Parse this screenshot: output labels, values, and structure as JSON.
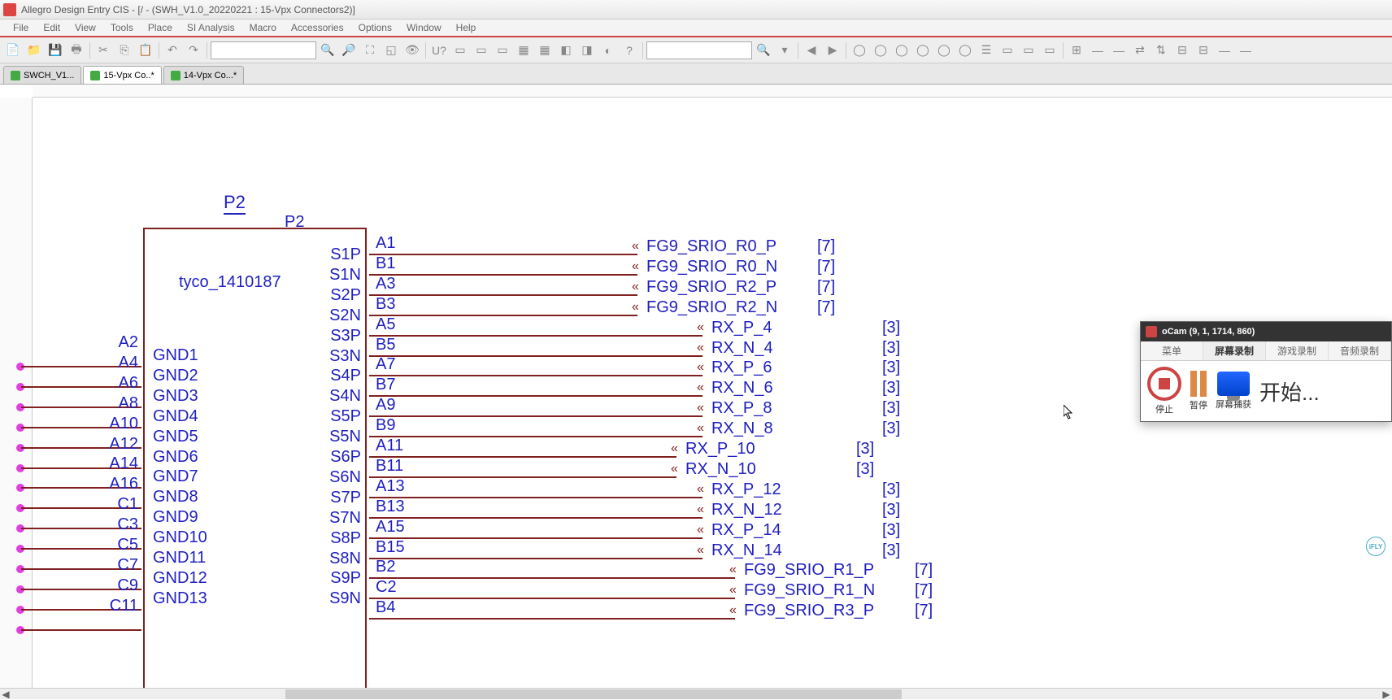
{
  "titlebar": "Allegro Design Entry CIS - [/ - (SWH_V1.0_20220221 : 15-Vpx Connectors2)]",
  "menu": [
    "File",
    "Edit",
    "View",
    "Tools",
    "Place",
    "SI Analysis",
    "Macro",
    "Accessories",
    "Options",
    "Window",
    "Help"
  ],
  "tabs": [
    {
      "label": "SWCH_V1...",
      "active": false
    },
    {
      "label": "15-Vpx Co..*",
      "active": true
    },
    {
      "label": "14-Vpx Co...*",
      "active": false
    }
  ],
  "schematic": {
    "refdes": "P2",
    "refdes2": "P2",
    "partname": "tyco_1410187",
    "left_pins": [
      "A2",
      "A4",
      "A6",
      "A8",
      "A10",
      "A12",
      "A14",
      "A16",
      "C1",
      "C3",
      "C5",
      "C7",
      "C9",
      "C11"
    ],
    "left_inner": [
      "GND1",
      "GND2",
      "GND3",
      "GND4",
      "GND5",
      "GND6",
      "GND7",
      "GND8",
      "GND9",
      "GND10",
      "GND11",
      "GND12",
      "GND13"
    ],
    "right_inner": [
      "S1P",
      "S1N",
      "S2P",
      "S2N",
      "S3P",
      "S3N",
      "S4P",
      "S4N",
      "S5P",
      "S5N",
      "S6P",
      "S6N",
      "S7P",
      "S7N",
      "S8P",
      "S8N",
      "S9P",
      "S9N"
    ],
    "right_pins": [
      "A1",
      "B1",
      "A3",
      "B3",
      "A5",
      "B5",
      "A7",
      "B7",
      "A9",
      "B9",
      "A11",
      "B11",
      "A13",
      "B13",
      "A15",
      "B15",
      "B2",
      "C2",
      "B4"
    ],
    "nets": [
      {
        "name": "FG9_SRIO_R0_P",
        "page": "[7]",
        "row": 0
      },
      {
        "name": "FG9_SRIO_R0_N",
        "page": "[7]",
        "row": 1
      },
      {
        "name": "FG9_SRIO_R2_P",
        "page": "[7]",
        "row": 2
      },
      {
        "name": "FG9_SRIO_R2_N",
        "page": "[7]",
        "row": 3
      },
      {
        "name": "RX_P_4",
        "page": "[3]",
        "row": 4,
        "indent": 1
      },
      {
        "name": "RX_N_4",
        "page": "[3]",
        "row": 5,
        "indent": 1
      },
      {
        "name": "RX_P_6",
        "page": "[3]",
        "row": 6,
        "indent": 1
      },
      {
        "name": "RX_N_6",
        "page": "[3]",
        "row": 7,
        "indent": 1
      },
      {
        "name": "RX_P_8",
        "page": "[3]",
        "row": 8,
        "indent": 1
      },
      {
        "name": "RX_N_8",
        "page": "[3]",
        "row": 9,
        "indent": 1
      },
      {
        "name": "RX_P_10",
        "page": "[3]",
        "row": 10,
        "indent": 0.6
      },
      {
        "name": "RX_N_10",
        "page": "[3]",
        "row": 11,
        "indent": 0.6
      },
      {
        "name": "RX_P_12",
        "page": "[3]",
        "row": 12,
        "indent": 1
      },
      {
        "name": "RX_N_12",
        "page": "[3]",
        "row": 13,
        "indent": 1
      },
      {
        "name": "RX_P_14",
        "page": "[3]",
        "row": 14,
        "indent": 1
      },
      {
        "name": "RX_N_14",
        "page": "[3]",
        "row": 15,
        "indent": 1
      },
      {
        "name": "FG9_SRIO_R1_P",
        "page": "[7]",
        "row": 16,
        "indent": 1.5
      },
      {
        "name": "FG9_SRIO_R1_N",
        "page": "[7]",
        "row": 17,
        "indent": 1.5
      },
      {
        "name": "FG9_SRIO_R3_P",
        "page": "[7]",
        "row": 18,
        "indent": 1.5
      }
    ]
  },
  "ocam": {
    "title": "oCam (9, 1, 1714, 860)",
    "tabs": [
      "菜单",
      "屏幕录制",
      "游戏录制",
      "音频录制"
    ],
    "stop": "停止",
    "pause": "暂停",
    "capture": "屏幕捕获",
    "start": "开始..."
  }
}
